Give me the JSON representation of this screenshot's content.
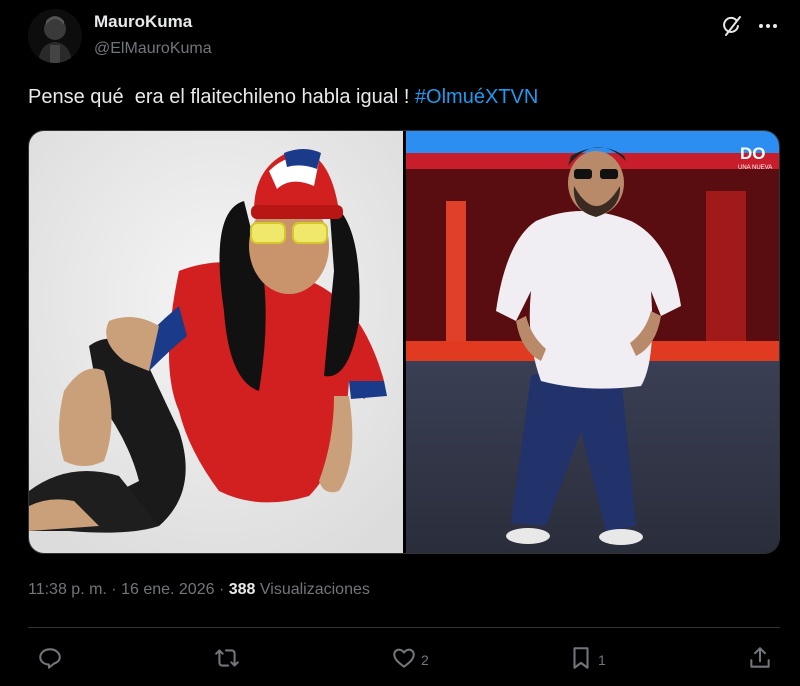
{
  "author": {
    "display_name": "MauroKuma",
    "handle": "@ElMauroKuma"
  },
  "post": {
    "text": "Pense qué  era el flaitechileno habla igual ! ",
    "hashtag": "#OlmuéXTVN"
  },
  "media": {
    "left_image": "man in Chile jersey and wig with sunglasses and flag hat",
    "right_image": "man on stage in white t-shirt and jeans",
    "right_image_overlay": "DO",
    "right_image_overlay_sub": "UNA NUEVA"
  },
  "meta": {
    "time": "11:38 p. m.",
    "date": "16 ene. 2026",
    "separator": " · ",
    "views_count": "388",
    "views_label": "Visualizaciones"
  },
  "actions": {
    "reply_icon": "reply-icon",
    "retweet_icon": "retweet-icon",
    "like_icon": "heart-icon",
    "like_count": "2",
    "bookmark_icon": "bookmark-icon",
    "bookmark_count": "1",
    "share_icon": "share-icon"
  },
  "colors": {
    "background": "#000000",
    "text": "#e7e9ea",
    "secondary": "#71767b",
    "accent": "#1d9bf0",
    "divider": "#2f3336"
  }
}
